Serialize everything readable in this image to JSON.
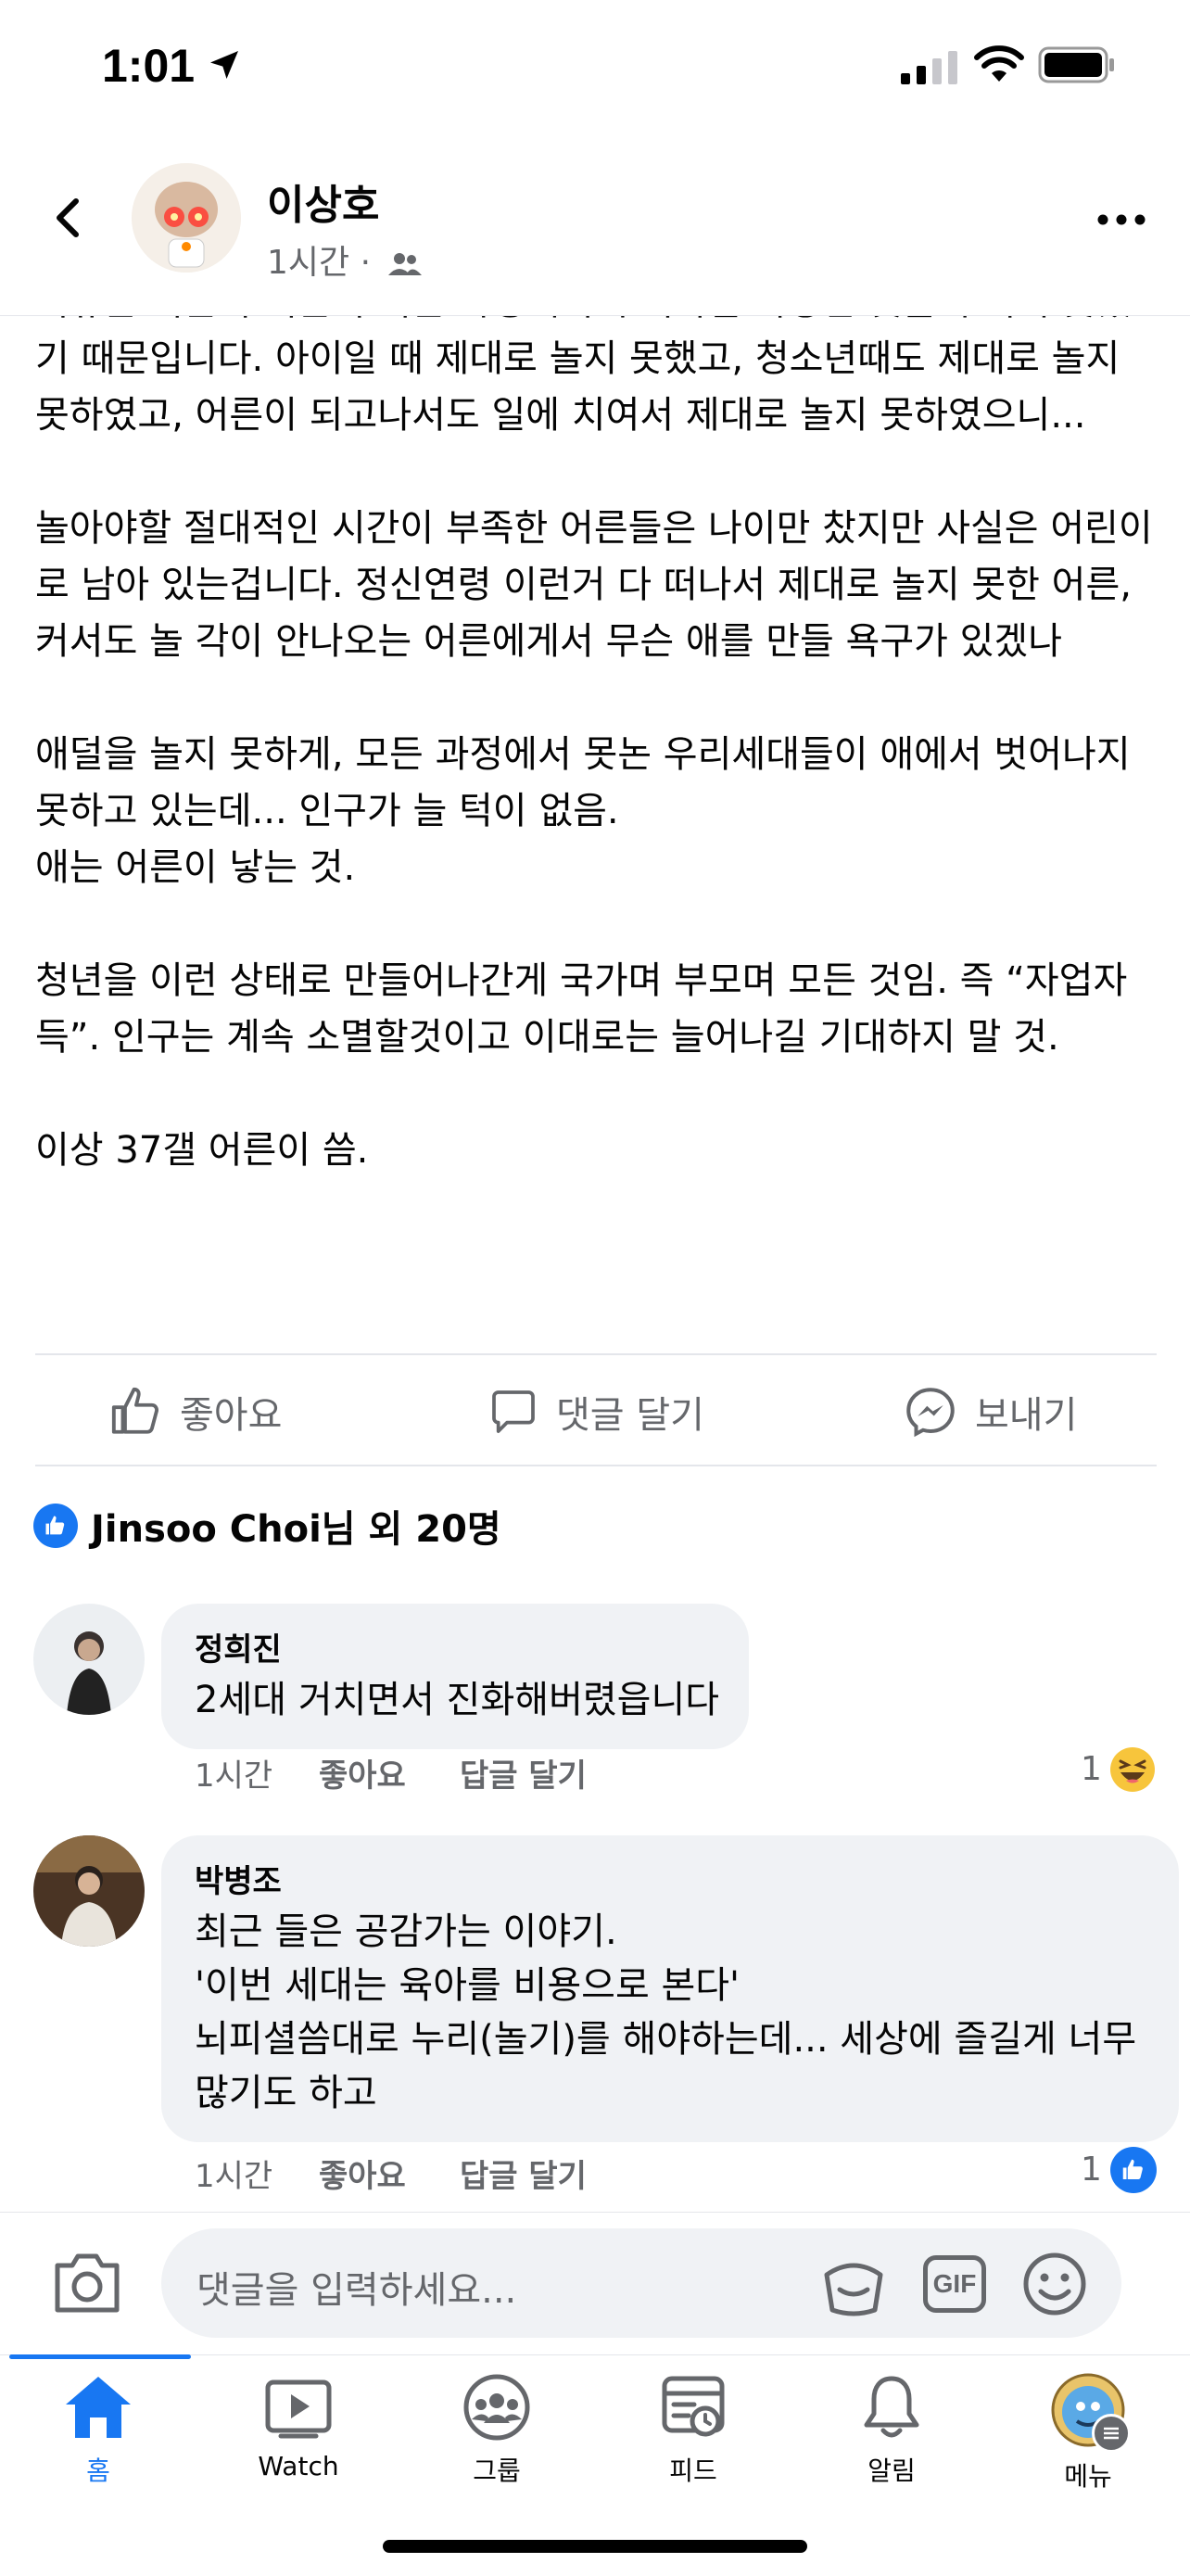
{
  "status": {
    "time": "1:01"
  },
  "post": {
    "author": "이상호",
    "meta": "1시간 ·",
    "body": "이유는 어른이 어른이 되는 과정에서 누려야할 다양한 것을 누리지 못했기 때문입니다. 아이일 때 제대로 놀지 못했고, 청소년때도 제대로 놀지 못하였고, 어른이 되고나서도 일에 치여서 제대로 놀지 못하였으니...\n\n놀아야할 절대적인 시간이 부족한 어른들은 나이만 찼지만 사실은 어린이로 남아 있는겁니다. 정신연령 이런거 다 떠나서 제대로 놀지 못한 어른, 커서도 놀 각이 안나오는 어른에게서 무슨 애를 만들 욕구가 있겠나\n\n애덜을 놀지 못하게, 모든 과정에서 못논 우리세대들이 애에서 벗어나지 못하고 있는데... 인구가 늘 턱이 없음.\n애는 어른이 낳는 것.\n\n청년을 이런 상태로 만들어나간게 국가며 부모며 모든 것임. 즉 “자업자득”. 인구는 계속 소멸할것이고 이대로는 늘어나길 기대하지 말 것.\n\n이상 37갤 어른이 씀."
  },
  "actions": {
    "like": "좋아요",
    "comment": "댓글 달기",
    "send": "보내기"
  },
  "reactions": {
    "summary": "Jinsoo Choi님 외 20명"
  },
  "comments": [
    {
      "name": "정희진",
      "text": "2세대 거치면서 진화해버렸읍니다",
      "time": "1시간",
      "like": "좋아요",
      "reply": "답글 달기",
      "count": "1",
      "reaction": "haha"
    },
    {
      "name": "박병조",
      "text": "최근 들은 공감가는 이야기.\n'이번 세대는 육아를 비용으로 본다'\n뇌피셜씀대로 누리(놀기)를 해야하는데... 세상에 즐길게 너무 많기도 하고",
      "time": "1시간",
      "like": "좋아요",
      "reply": "답글 달기",
      "count": "1",
      "reaction": "like"
    }
  ],
  "input": {
    "placeholder": "댓글을 입력하세요...",
    "gif": "GIF"
  },
  "tabs": [
    {
      "label": "홈",
      "icon": "home-icon",
      "active": true
    },
    {
      "label": "Watch",
      "icon": "watch-icon"
    },
    {
      "label": "그룹",
      "icon": "groups-icon"
    },
    {
      "label": "피드",
      "icon": "feed-icon"
    },
    {
      "label": "알림",
      "icon": "bell-icon"
    },
    {
      "label": "메뉴",
      "icon": "menu-avatar"
    }
  ],
  "colors": {
    "accent": "#1877f2",
    "muted": "#65676b",
    "bubble": "#f0f2f5"
  }
}
